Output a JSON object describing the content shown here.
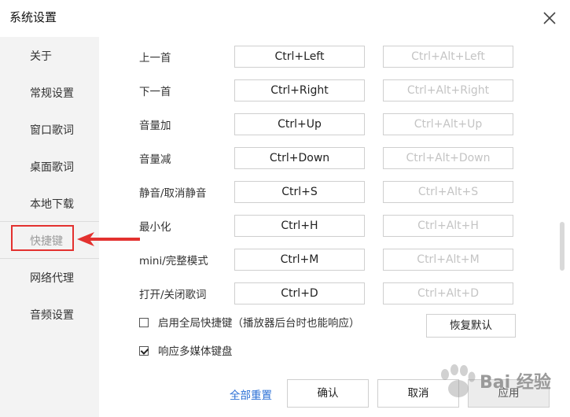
{
  "window": {
    "title": "系统设置"
  },
  "sidebar": {
    "items": [
      {
        "label": "关于"
      },
      {
        "label": "常规设置"
      },
      {
        "label": "窗口歌词"
      },
      {
        "label": "桌面歌词"
      },
      {
        "label": "本地下载"
      },
      {
        "label": "快捷键",
        "active": true
      },
      {
        "label": "网络代理"
      },
      {
        "label": "音频设置"
      }
    ]
  },
  "hotkeys": [
    {
      "action": "上一首",
      "primary": "Ctrl+Left",
      "global": "Ctrl+Alt+Left"
    },
    {
      "action": "下一首",
      "primary": "Ctrl+Right",
      "global": "Ctrl+Alt+Right"
    },
    {
      "action": "音量加",
      "primary": "Ctrl+Up",
      "global": "Ctrl+Alt+Up"
    },
    {
      "action": "音量减",
      "primary": "Ctrl+Down",
      "global": "Ctrl+Alt+Down"
    },
    {
      "action": "静音/取消静音",
      "primary": "Ctrl+S",
      "global": "Ctrl+Alt+S"
    },
    {
      "action": "最小化",
      "primary": "Ctrl+H",
      "global": "Ctrl+Alt+H"
    },
    {
      "action": "mini/完整模式",
      "primary": "Ctrl+M",
      "global": "Ctrl+Alt+M"
    },
    {
      "action": "打开/关闭歌词",
      "primary": "Ctrl+D",
      "global": "Ctrl+Alt+D"
    }
  ],
  "options": {
    "global_hotkeys": {
      "label": "启用全局快捷键（播放器后台时也能响应）",
      "checked": false
    },
    "media_keys": {
      "label": "响应多媒体键盘",
      "checked": true
    }
  },
  "buttons": {
    "restore_default": "恢复默认",
    "reset_all": "全部重置",
    "confirm": "确认",
    "cancel": "取消",
    "apply": "应用"
  },
  "watermark": {
    "text": "Bai 经验"
  },
  "colors": {
    "highlight": "#e3312f",
    "link": "#2a6fd6"
  }
}
